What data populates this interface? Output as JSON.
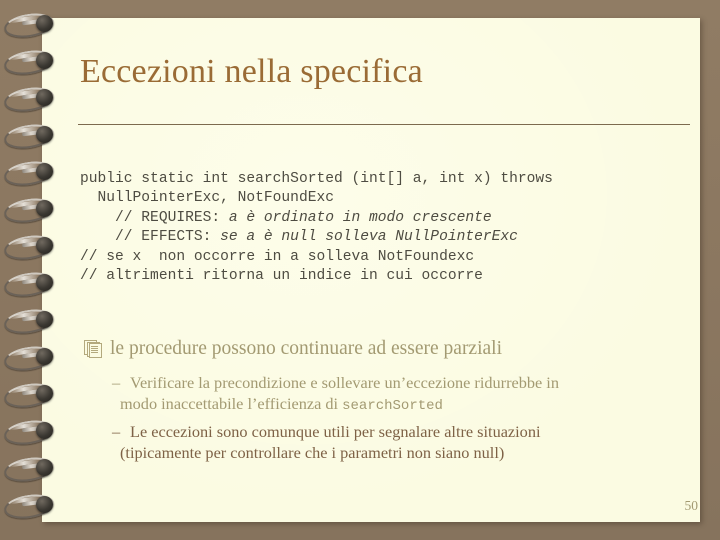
{
  "slide": {
    "title": "Eccezioni nella specifica",
    "number": "50",
    "colors": {
      "background": "#8d7a63",
      "paper": "#fbfbe2",
      "title": "#9a6b35",
      "rule": "#7c6a4e",
      "code_text": "#4e4c42",
      "bullet_text": "#a39a72",
      "bullet_text_dark": "#7e6246"
    }
  },
  "code_block": {
    "lines": [
      {
        "segments": [
          {
            "text": "public static int searchSorted (int[] a, int x) throws",
            "style": "normal"
          }
        ]
      },
      {
        "segments": [
          {
            "text": "  NullPointerExc, NotFoundExc",
            "style": "normal"
          }
        ]
      },
      {
        "segments": [
          {
            "text": "    // REQUIRES: ",
            "style": "normal"
          },
          {
            "text": "a è ordinato in modo crescente",
            "style": "italic"
          }
        ]
      },
      {
        "segments": [
          {
            "text": "    // EFFECTS: ",
            "style": "normal"
          },
          {
            "text": "se a è null solleva NullPointerExc",
            "style": "italic"
          }
        ]
      },
      {
        "segments": [
          {
            "text": "// se x  non occorre in a solleva NotFoundexc",
            "style": "normal"
          }
        ]
      },
      {
        "segments": [
          {
            "text": "// altrimenti ritorna un indice in cui occorre",
            "style": "normal"
          }
        ]
      }
    ]
  },
  "bullets": {
    "level1": {
      "bullet_icon": "stacked-pages-icon",
      "text": "le procedure possono continuare ad essere parziali"
    },
    "level2": [
      {
        "dash": "–",
        "line1": "Verificare la precondizione e sollevare un’eccezione ridurrebbe in",
        "line2_prefix": "modo inaccettabile l’efficienza di ",
        "line2_mono": "searchSorted",
        "dark": false
      },
      {
        "dash": "–",
        "line1": "Le eccezioni sono comunque utili per segnalare altre situazioni",
        "line2_prefix": "(tipicamente per controllare che i parametri non siano null)",
        "line2_mono": "",
        "dark": true
      }
    ]
  }
}
